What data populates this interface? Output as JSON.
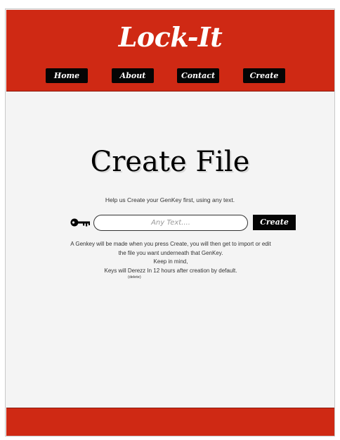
{
  "header": {
    "title": "Lock-It",
    "nav": [
      {
        "label": "Home"
      },
      {
        "label": "About"
      },
      {
        "label": "Contact"
      },
      {
        "label": "Create"
      }
    ]
  },
  "main": {
    "heading": "Create File",
    "help": "Help us Create your GenKey first, using any text.",
    "input": {
      "placeholder": "Any Text....",
      "value": ""
    },
    "create_label": "Create",
    "info_lines": [
      "A Genkey will be made when you press Create, you will then get to import or edit",
      "the file you want underneath that GenKey.",
      "Keep in mind,",
      "Keys will Derezz In 12 hours after creation by default."
    ],
    "delete_label": "(delete)"
  },
  "icons": {
    "key": "key-icon"
  },
  "colors": {
    "brand": "#cf2914",
    "button": "#050505",
    "background": "#f4f4f4"
  }
}
